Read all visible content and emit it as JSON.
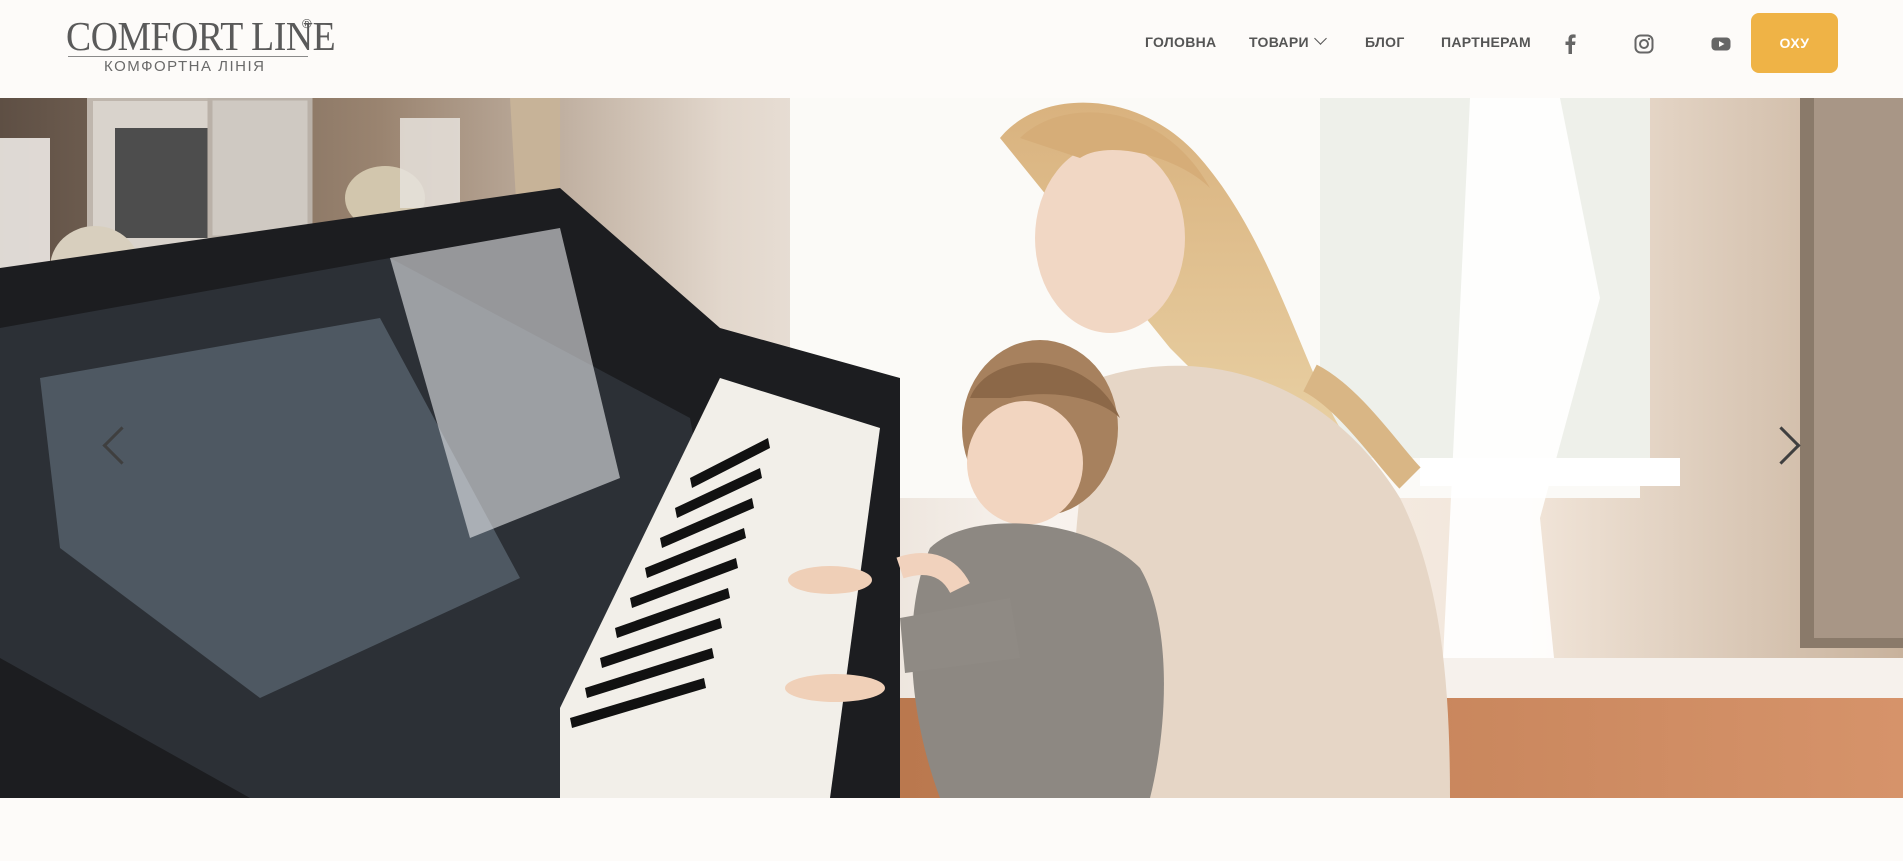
{
  "brand": {
    "name": "COMFORT LINE",
    "registered": "®",
    "subtitle": "КОМФОРТНА ЛІНІЯ"
  },
  "nav": {
    "items": [
      {
        "label": "ГОЛОВНА"
      },
      {
        "label": "ТОВАРИ",
        "has_dropdown": true
      },
      {
        "label": "БЛОГ"
      },
      {
        "label": "ПАРТНЕРАМ"
      }
    ],
    "social": [
      {
        "icon": "facebook-icon"
      },
      {
        "icon": "instagram-icon"
      },
      {
        "icon": "youtube-icon"
      }
    ],
    "cta_label": "ОХУ"
  },
  "hero": {
    "image": "mother-and-child-playing-piano",
    "prev_icon": "chevron-left-icon",
    "next_icon": "chevron-right-icon"
  },
  "colors": {
    "background": "#fdfbf9",
    "accent": "#efb346",
    "nav_text": "#555555"
  }
}
